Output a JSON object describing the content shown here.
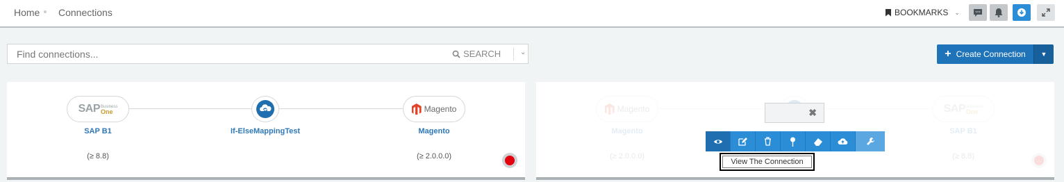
{
  "breadcrumb": {
    "home": "Home",
    "current": "Connections"
  },
  "header": {
    "bookmarks_label": "BOOKMARKS"
  },
  "search": {
    "placeholder": "Find connections...",
    "button_label": "SEARCH"
  },
  "create_button": {
    "label": "Create Connection"
  },
  "connections": [
    {
      "source": {
        "name": "SAP B1",
        "version": "(≥ 8.8)",
        "logo_text": "SAP",
        "logo_sub1": "Business",
        "logo_sub2": "One"
      },
      "mapping": "If-ElseMappingTest",
      "target": {
        "name": "Magento",
        "version": "(≥ 2.0.0.0)",
        "logo_text": "Magento"
      },
      "status_color": "#e3000f"
    },
    {
      "source": {
        "name": "Magento",
        "version": "(≥ 2.0.0.0)",
        "logo_text": "Magento"
      },
      "mapping": "",
      "target": {
        "name": "SAP B1",
        "version": "(≥ 8.8)",
        "logo_text": "SAP",
        "logo_sub1": "Business",
        "logo_sub2": "One"
      },
      "status_color": "#e3000f"
    }
  ],
  "toolbar": {
    "actions": [
      "view-icon",
      "edit-icon",
      "delete-icon",
      "pin-icon",
      "eraser-icon",
      "cloud-upload-icon",
      "wrench-icon"
    ],
    "tooltip": "View The Connection",
    "close_glyph": "✖"
  },
  "colors": {
    "primary": "#2b8dd6",
    "create": "#1e73b9",
    "link": "#2f78b7",
    "status_error": "#e3000f"
  }
}
